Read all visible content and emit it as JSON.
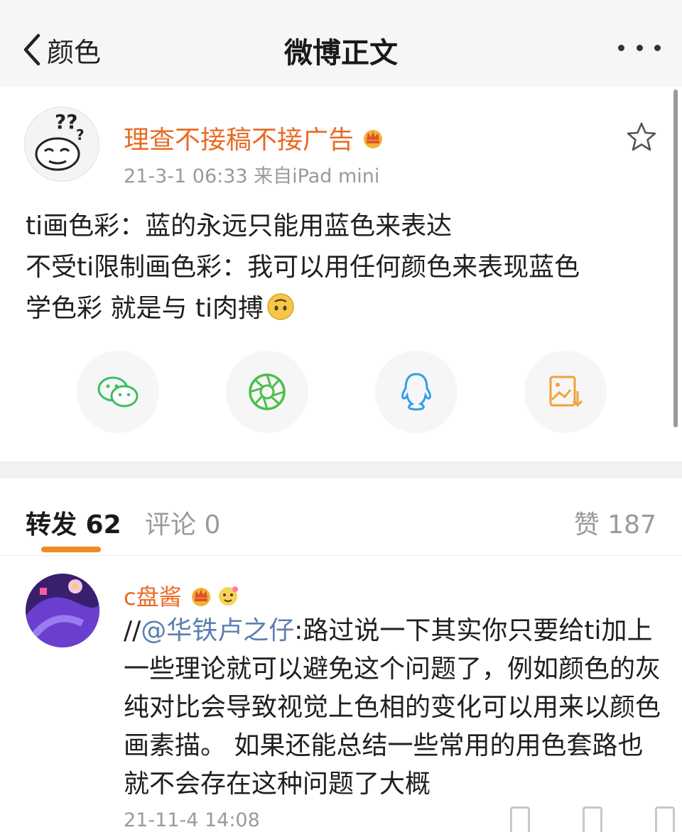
{
  "nav": {
    "back_label": "颜色",
    "title": "微博正文"
  },
  "post": {
    "author": "理查不接稿不接广告",
    "meta": "21-3-1 06:33  来自iPad mini",
    "lines": [
      "ti画色彩：蓝的永远只能用蓝色来表达",
      "不受ti限制画色彩：我可以用任何颜色来表现蓝色",
      "学色彩 就是与 ti肉搏"
    ]
  },
  "tabs": {
    "repost": "转发 62",
    "comments": "评论 0",
    "likes": "赞 187"
  },
  "comment": {
    "name": "c盘酱",
    "prefix": "//",
    "mention": "@华铁卢之仔",
    "text": ":路过说一下其实你只要给ti加上一些理论就可以避免这个问题了，例如颜色的灰纯对比会导致视觉上色相的变化可以用来以颜色画素描。 如果还能总结一些常用的用色套路也就不会存在这种问题了大概",
    "time": "21-11-4 14:08"
  },
  "icons": {
    "back": "chevron-left-icon",
    "more": "more-dots-icon",
    "star": "star-outline-icon",
    "wechat": "wechat-icon",
    "moments": "moments-aperture-icon",
    "qq": "qq-icon",
    "save_image": "save-image-icon"
  },
  "colors": {
    "author": "#e86b25",
    "mention": "#5b7fb0",
    "accent": "#f08a25",
    "wechat": "#3dbd62",
    "moments": "#4cbf4a",
    "qq": "#2f9ee8",
    "save": "#f0a23a"
  }
}
